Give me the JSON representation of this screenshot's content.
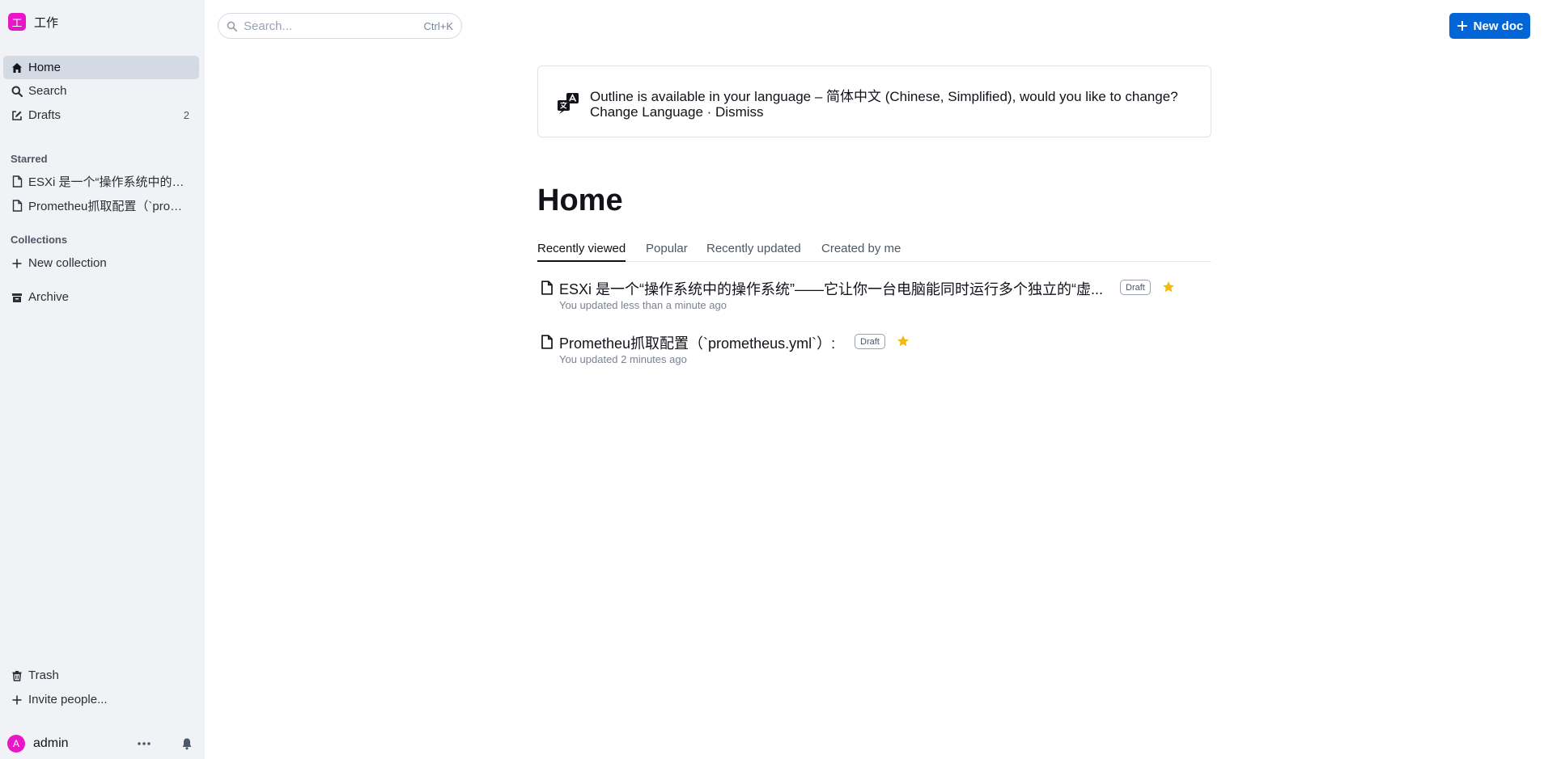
{
  "sidebar": {
    "team": {
      "logo_letter": "工",
      "name": "工作"
    },
    "nav": {
      "home": "Home",
      "search": "Search",
      "drafts": "Drafts",
      "drafts_count": "2"
    },
    "starred": {
      "title": "Starred",
      "items": [
        "ESXi 是一个“操作系统中的操作系统”——它让你一台电脑能同时运行多个独立的“虚拟电脑”",
        "Prometheu抓取配置（`prometheus.yml`）:"
      ]
    },
    "collections": {
      "title": "Collections",
      "new_collection": "New collection"
    },
    "archive": "Archive",
    "trash": "Trash",
    "invite": "Invite people...",
    "user": {
      "avatar_letter": "A",
      "name": "admin"
    }
  },
  "header": {
    "search_placeholder": "Search...",
    "search_shortcut": "Ctrl+K",
    "new_doc": "New doc"
  },
  "banner": {
    "message": "Outline is available in your language – 简体中文 (Chinese, Simplified), would you like to change?",
    "change_language": "Change Language",
    "separator": " · ",
    "dismiss": "Dismiss"
  },
  "main": {
    "title": "Home",
    "tabs": [
      "Recently viewed",
      "Popular",
      "Recently updated",
      "Created by me"
    ],
    "documents": [
      {
        "title": "ESXi 是一个“操作系统中的操作系统”——它让你一台电脑能同时运行多个独立的“虚...",
        "badge": "Draft",
        "meta": "You updated less than a minute ago"
      },
      {
        "title": "Prometheu抓取配置（`prometheus.yml`）:",
        "badge": "Draft",
        "meta": "You updated 2 minutes ago"
      }
    ]
  },
  "colors": {
    "accent": "#0366d6",
    "team_logo": "#e816c8",
    "star": "#f2bb0b",
    "sidebar_bg": "#f0f2f6"
  },
  "icons": [
    "home-icon",
    "search-icon",
    "edit-icon",
    "document-icon",
    "plus-icon",
    "archive-icon",
    "trash-icon",
    "more-icon",
    "bell-icon",
    "translate-icon",
    "star-icon"
  ]
}
